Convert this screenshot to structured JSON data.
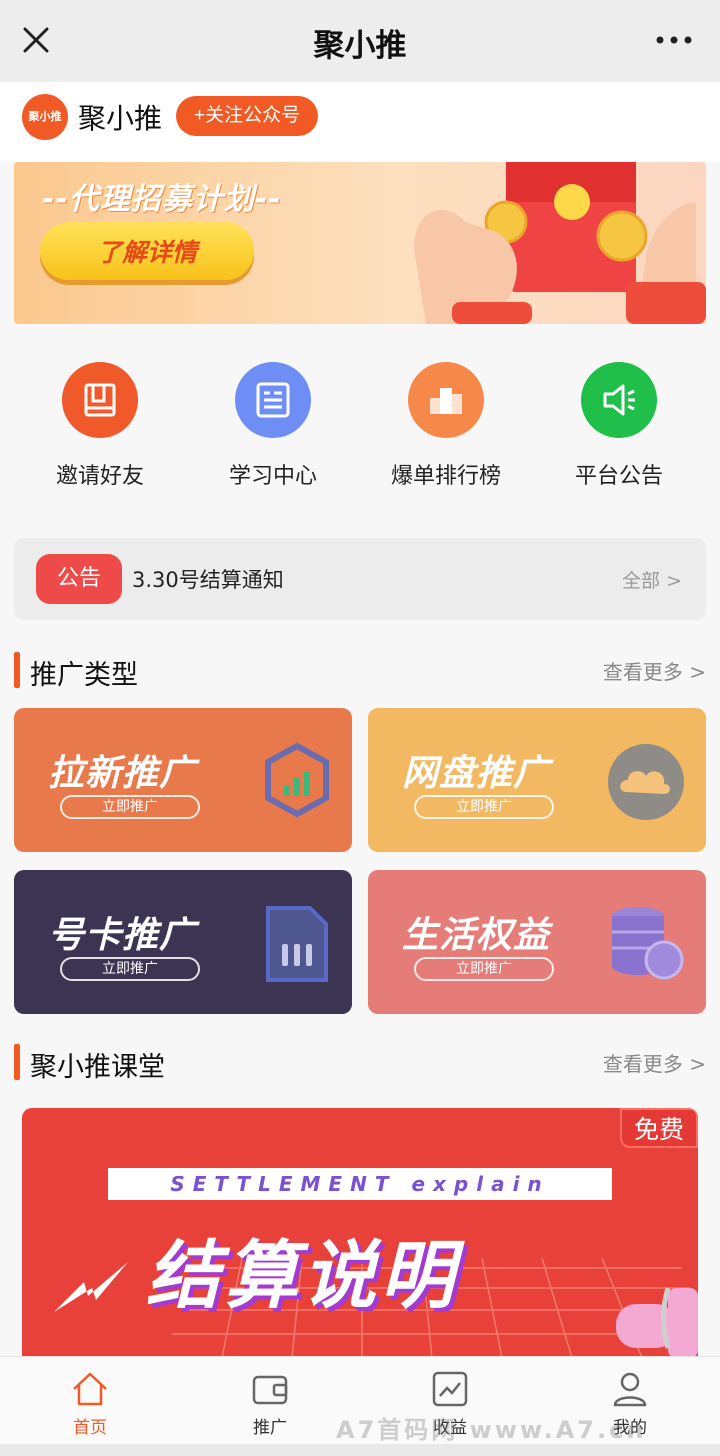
{
  "nav": {
    "title": "聚小推"
  },
  "account": {
    "logo_text": "聚小推",
    "name": "聚小推",
    "follow_label": "+关注公众号"
  },
  "banner": {
    "headline": "--代理招募计划--",
    "cta_label": "了解详情"
  },
  "quick_links": [
    {
      "label": "邀请好友",
      "icon": "book-icon",
      "color": "#f0592a"
    },
    {
      "label": "学习中心",
      "icon": "list-icon",
      "color": "#6e8ef5"
    },
    {
      "label": "爆单排行榜",
      "icon": "ranking-icon",
      "color": "#f6894a"
    },
    {
      "label": "平台公告",
      "icon": "speaker-icon",
      "color": "#1fbf4a"
    }
  ],
  "notice": {
    "tag": "公告",
    "text": "3.30号结算通知",
    "all_label": "全部 >"
  },
  "promo_section": {
    "title": "推广类型",
    "more_label": "查看更多 >"
  },
  "promo_cards": [
    {
      "title": "拉新推广",
      "action": "立即推广",
      "color": "#e8794a",
      "icon": "hexagon-chart-icon"
    },
    {
      "title": "网盘推广",
      "action": "立即推广",
      "color": "#f2b862",
      "icon": "cloud-icon"
    },
    {
      "title": "号卡推广",
      "action": "立即推广",
      "color": "#3b3553",
      "icon": "sim-card-icon"
    },
    {
      "title": "生活权益",
      "action": "立即推广",
      "color": "#e57c78",
      "icon": "coin-stack-icon"
    }
  ],
  "course_section": {
    "title": "聚小推课堂",
    "more_label": "查看更多 >"
  },
  "course": {
    "badge": "免费",
    "english": "SETTLEMENT explain",
    "title": "结算说明"
  },
  "tabs": [
    {
      "label": "首页",
      "icon": "home-icon",
      "active": true
    },
    {
      "label": "推广",
      "icon": "wallet-icon",
      "active": false
    },
    {
      "label": "收益",
      "icon": "trend-chart-icon",
      "active": false
    },
    {
      "label": "我的",
      "icon": "user-icon",
      "active": false
    }
  ],
  "watermark": "A7首码网 www.A7.cn"
}
